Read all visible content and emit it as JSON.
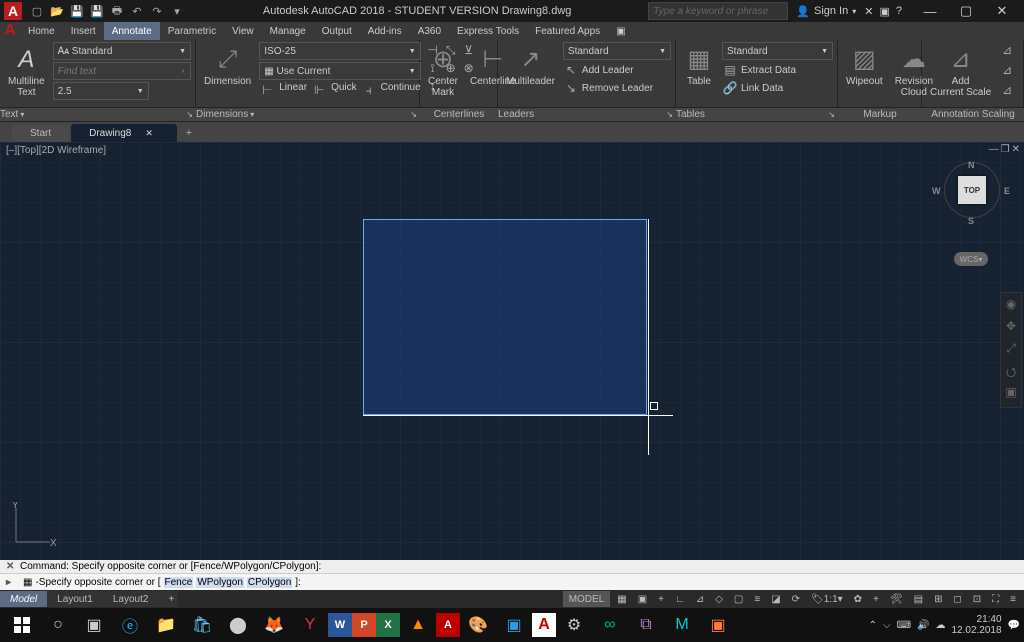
{
  "title": "Autodesk AutoCAD 2018 - STUDENT VERSION   Drawing8.dwg",
  "search_placeholder": "Type a keyword or phrase",
  "sign_in": "Sign In",
  "menu": [
    "Home",
    "Insert",
    "Annotate",
    "Parametric",
    "View",
    "Manage",
    "Output",
    "Add-ins",
    "A360",
    "Express Tools",
    "Featured Apps"
  ],
  "ribbon": {
    "text": {
      "style": "Standard",
      "find": "Find text",
      "height": "2.5",
      "big": "Multiline\nText",
      "panel": "Text"
    },
    "dim": {
      "style": "ISO-25",
      "layer": "Use Current",
      "sub": [
        "Linear",
        "Quick",
        "Continue"
      ],
      "big": "Dimension",
      "panel": "Dimensions"
    },
    "center": {
      "a": "Center\nMark",
      "b": "Centerline",
      "panel": "Centerlines"
    },
    "leader": {
      "style": "Standard",
      "a": "Add Leader",
      "b": "Remove Leader",
      "big": "Multileader",
      "panel": "Leaders"
    },
    "table": {
      "style": "Standard",
      "a": "Extract Data",
      "b": "Link Data",
      "big": "Table",
      "panel": "Tables"
    },
    "markup": {
      "a": "Wipeout",
      "b": "Revision\nCloud",
      "panel": "Markup"
    },
    "anno": {
      "a": "Add\nCurrent Scale",
      "panel": "Annotation Scaling"
    }
  },
  "doc_tabs": {
    "start": "Start",
    "active": "Drawing8"
  },
  "viewport_label": "[–][Top][2D Wireframe]",
  "viewcube": {
    "top": "TOP",
    "n": "N",
    "e": "E",
    "s": "S",
    "w": "W",
    "wcs": "WCS"
  },
  "ucs": {
    "x": "X",
    "y": "Y"
  },
  "cmd": {
    "hist": "Command: Specify opposite corner or [Fence/WPolygon/CPolygon]:",
    "prompt": "-Specify opposite corner or [",
    "fence": "Fence",
    "wp": "WPolygon",
    "cp": "CPolygon",
    "close": "]:"
  },
  "layouts": {
    "model": "Model",
    "l1": "Layout1",
    "l2": "Layout2"
  },
  "status": {
    "model": "MODEL",
    "scale": "1:1"
  },
  "tray": {
    "time": "21:40",
    "date": "12.02.2018"
  }
}
